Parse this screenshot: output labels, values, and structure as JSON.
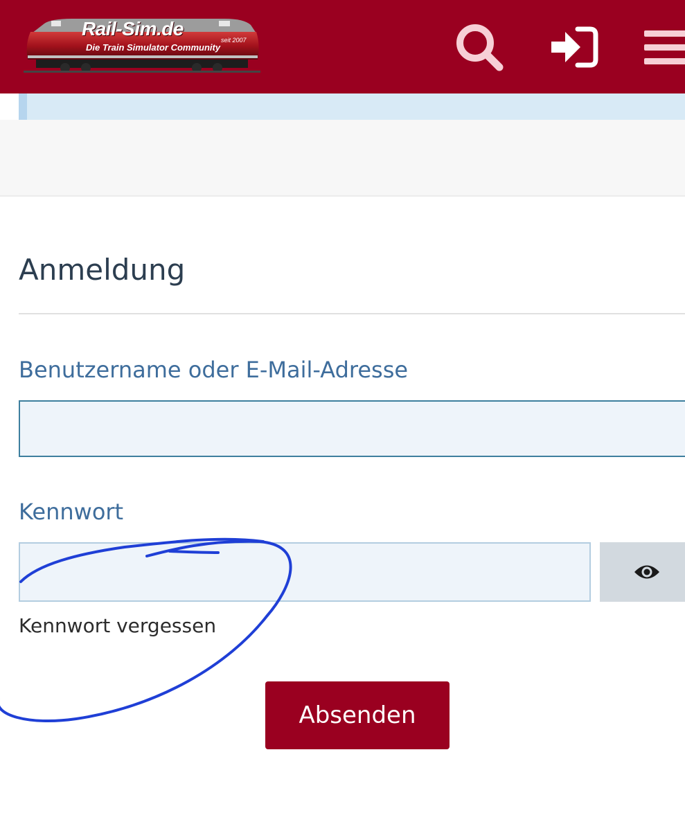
{
  "header": {
    "logo": {
      "title": "Rail-Sim.de",
      "tagline": "Die Train Simulator Community",
      "since": "seit 2007"
    },
    "icons": [
      "search-icon",
      "login-icon",
      "menu-icon"
    ],
    "color": "#9a0020"
  },
  "form": {
    "title": "Anmeldung",
    "username_label": "Benutzername oder E-Mail-Adresse",
    "username_value": "",
    "password_label": "Kennwort",
    "password_value": "",
    "show_password_icon": "eye-icon",
    "forgot_link": "Kennwort vergessen",
    "submit_label": "Absenden"
  },
  "colors": {
    "brand": "#9a0020",
    "label": "#3e6d9c",
    "notice": "#d8eaf6",
    "annotation": "#1f3fd6"
  }
}
